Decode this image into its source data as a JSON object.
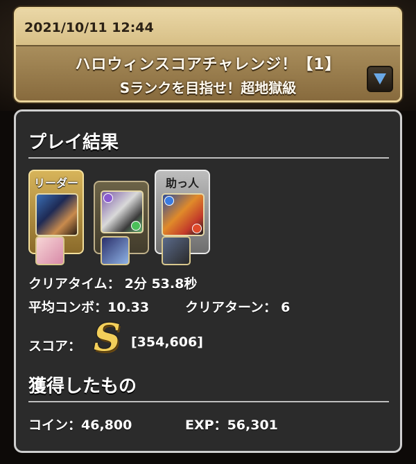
{
  "header": {
    "datetime": "2021/10/11 12:44",
    "title": "ハロウィンスコアチャレンジ！【1】",
    "subtitle": "Sランクを目指せ！超地獄級"
  },
  "result": {
    "section_title": "プレイ結果",
    "team": {
      "leader_label": "リーダー",
      "helper_label": "助っ人"
    },
    "clear_time_label": "クリアタイム：",
    "clear_time_value": "2分 53.8秒",
    "avg_combo_label": "平均コンボ：",
    "avg_combo_value": "10.33",
    "clear_turn_label": "クリアターン：",
    "clear_turn_value": "6",
    "score_label": "スコア：",
    "rank": "S",
    "score_value": "[354,606]"
  },
  "rewards": {
    "section_title": "獲得したもの",
    "coin_label": "コイン：",
    "coin_value": "46,800",
    "exp_label": "EXP：",
    "exp_value": "56,301"
  },
  "colors": {
    "header_gold": "#c7ab74",
    "panel_bg": "#2b2b2b",
    "rank_gold": "#f3cf5a",
    "expand_arrow": "#6aa8e6"
  },
  "icons": {
    "expand": "triangle-down-icon"
  }
}
